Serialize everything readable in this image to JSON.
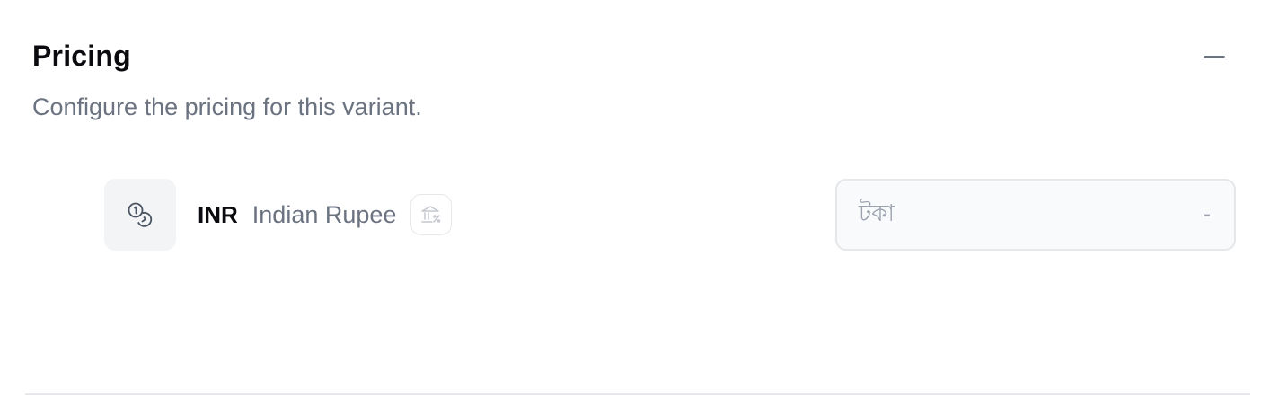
{
  "pricing": {
    "title": "Pricing",
    "description": "Configure the pricing for this variant.",
    "collapse_icon": "minus-icon"
  },
  "currency_row": {
    "icon": "coins-icon",
    "code": "INR",
    "name": "Indian Rupee",
    "tax_icon": "tax-inclusive-icon",
    "symbol": "টকা",
    "placeholder": "-"
  },
  "colors": {
    "text_primary": "#0b0b0f",
    "text_muted": "#6b7280",
    "border": "#e5e7eb",
    "input_bg": "#f9fafb",
    "tile_bg": "#f3f4f6"
  }
}
